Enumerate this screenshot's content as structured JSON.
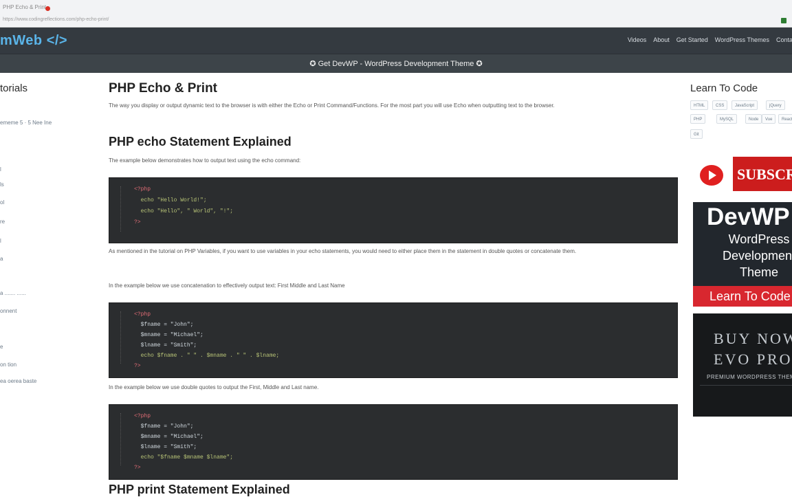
{
  "browser": {
    "tab_title": "PHP Echo & Print",
    "url": "https://www.codingreflections.com/php-echo-print/"
  },
  "site": {
    "brand": "mWeb </>",
    "nav": [
      "Videos",
      "About",
      "Get Started",
      "WordPress Themes",
      "Contact"
    ],
    "promo": "✪ Get DevWP - WordPress Development Theme ✪"
  },
  "left_sidebar": {
    "title": "torials",
    "items": [
      "ememe 5 · 5 Nee Ine",
      "l",
      "ls",
      "ol",
      "re",
      "l",
      "a",
      "a ....... ......",
      "onnent",
      "e",
      "on tion",
      "ea oerea baste"
    ]
  },
  "main": {
    "h1": "PHP Echo & Print",
    "intro": "The way you display or output dynamic text to the browser is with either the Echo or Print Command/Functions. For the most part you will use Echo when outputting text to the browser.",
    "h2_echo": "PHP echo Statement Explained",
    "echo_intro": "The example below demonstrates how to output text using the echo command:",
    "code1": [
      "<?php",
      "  echo \"Hello World!\";",
      "  echo \"Hello\", \" World\", \"!\";",
      "?>"
    ],
    "vars_para": "As mentioned in the tutorial on PHP Variables, if you want to use variables in your echo statements, you would need to either place them in the statement in double quotes or concatenate them.",
    "concat_para": "In the example below we use concatenation to effectively output text: First Middle and Last Name",
    "code2": [
      "<?php",
      "  $fname = \"John\";",
      "  $mname = \"Michael\";",
      "  $lname = \"Smith\";",
      "  echo $fname . \" \" . $mname . \" \" . $lname;",
      "?>"
    ],
    "dq_para": "In the example below we use double quotes to output the First, Middle and Last name.",
    "code3": [
      "<?php",
      "  $fname = \"John\";",
      "  $mname = \"Michael\";",
      "  $lname = \"Smith\";",
      "  echo \"$fname $mname $lname\";",
      "?>"
    ],
    "h2_print": "PHP print Statement Explained"
  },
  "right_sidebar": {
    "title": "Learn To Code",
    "tags": [
      "HTML",
      "CSS",
      "JavaScript",
      "jQuery",
      "PHP",
      "MySQL",
      "Node",
      "Vue",
      "React",
      "Git"
    ],
    "subscribe": "SUBSCRIBE",
    "devwp": {
      "title": "DevWP",
      "line1": "WordPress",
      "line2": "Development",
      "line3": "Theme",
      "cta": "Learn To Code"
    },
    "evo": {
      "line1": "BUY NOW",
      "line2": "EVO PRO",
      "sub": "PREMIUM WORDPRESS THEME"
    }
  },
  "colors": {
    "header_bg": "#343a40",
    "brand": "#5ab4e8",
    "code_bg": "#2b2d2f",
    "subscribe_red": "#cc1d1d"
  }
}
